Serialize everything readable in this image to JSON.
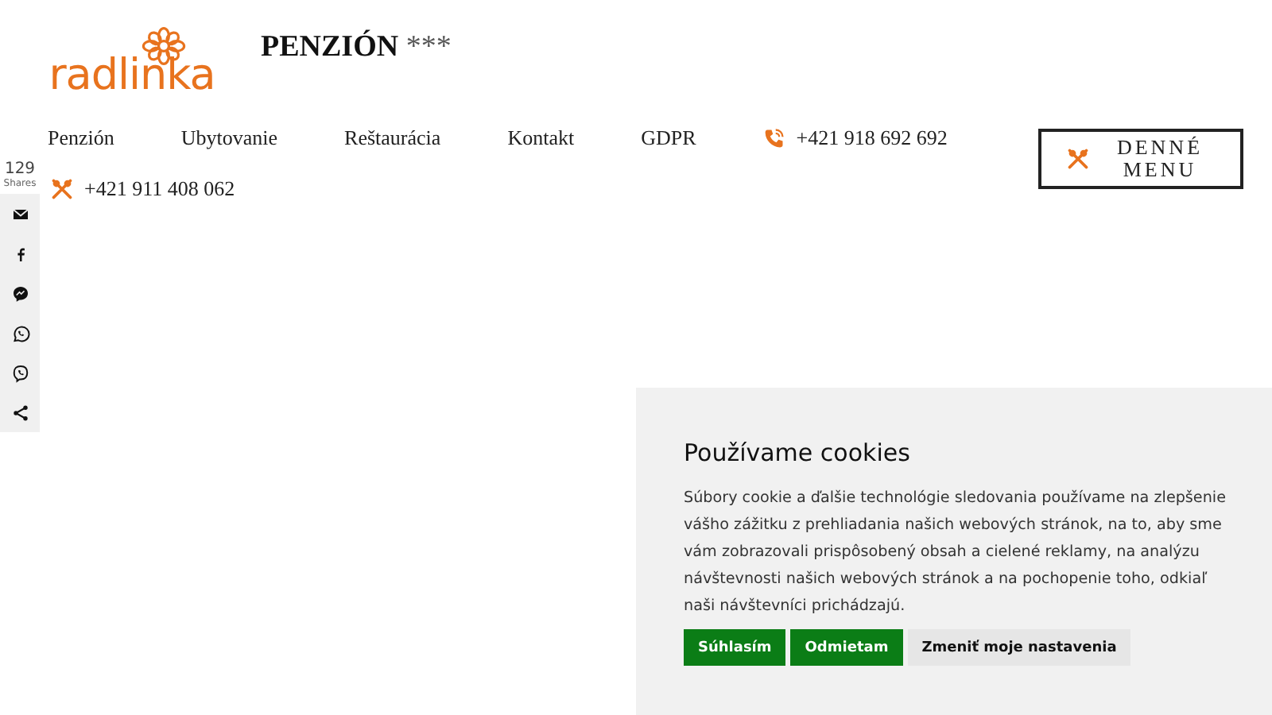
{
  "header": {
    "logo": "radlinka",
    "title": "PENZIÓN",
    "stars": "***"
  },
  "nav": {
    "links": [
      {
        "label": "Penzión"
      },
      {
        "label": "Ubytovanie"
      },
      {
        "label": "Reštaurácia"
      },
      {
        "label": "Kontakt"
      },
      {
        "label": "GDPR"
      }
    ],
    "contacts": [
      {
        "kind": "phone",
        "text": "+421 918 692 692"
      },
      {
        "kind": "restaurant",
        "text": "+421 911 408 062"
      }
    ],
    "menu_button": "DENNÉ MENU"
  },
  "share_bar": {
    "count": "129",
    "label": "Shares",
    "buttons": [
      {
        "kind": "email"
      },
      {
        "kind": "facebook"
      },
      {
        "kind": "messenger"
      },
      {
        "kind": "whatsapp"
      },
      {
        "kind": "viber"
      },
      {
        "kind": "share"
      }
    ]
  },
  "cookie_banner": {
    "title": "Používame cookies",
    "text": "Súbory cookie a ďalšie technológie sledovania používame na zlepšenie vášho zážitku z prehliadania našich webových stránok, na to, aby sme vám zobrazovali prispôsobený obsah a cielené reklamy, na analýzu návštevnosti našich webových stránok a na pochopenie toho, odkiaľ naši návštevníci prichádzajú.",
    "buttons": [
      {
        "kind": "primary",
        "label": "Súhlasím"
      },
      {
        "kind": "primary",
        "label": "Odmietam"
      },
      {
        "kind": "secondary",
        "label": "Zmeniť moje nastavenia"
      }
    ]
  }
}
